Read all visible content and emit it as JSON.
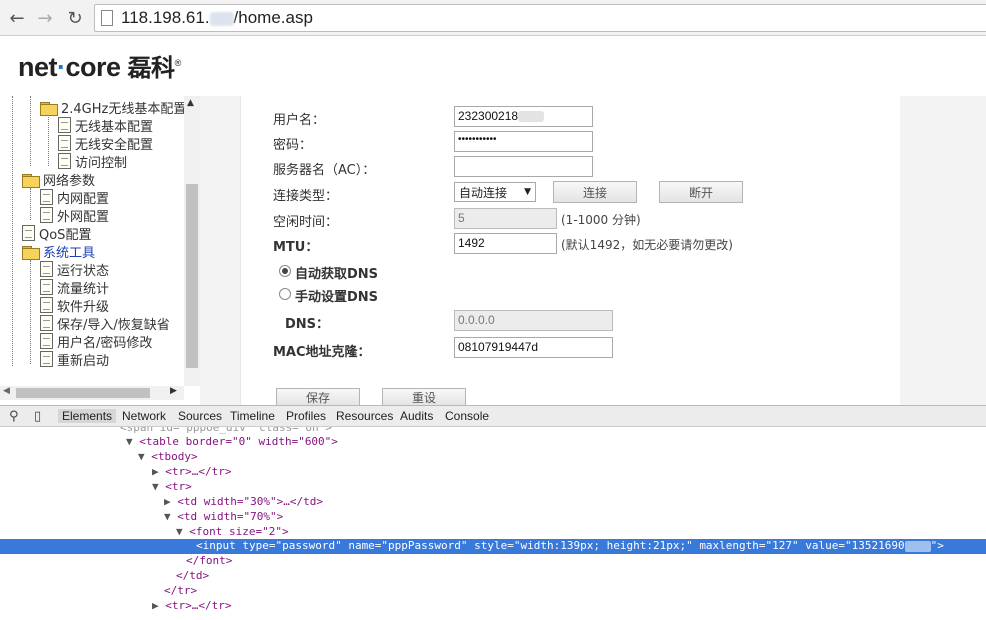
{
  "browser": {
    "url_prefix": "118.198.61.",
    "url_suffix": "/home.asp"
  },
  "logo": {
    "part1": "net",
    "part2": "core",
    "cn": "磊科",
    "reg": "®"
  },
  "tree": {
    "items": [
      {
        "label": "2.4GHz无线基本配置",
        "icon": "folder-open-icon",
        "level": 2
      },
      {
        "label": "无线基本配置",
        "icon": "page-icon",
        "level": 3
      },
      {
        "label": "无线安全配置",
        "icon": "page-icon",
        "level": 3
      },
      {
        "label": "访问控制",
        "icon": "page-icon",
        "level": 3
      },
      {
        "label": "网络参数",
        "icon": "folder-open-icon",
        "level": 1
      },
      {
        "label": "内网配置",
        "icon": "page-icon",
        "level": 2
      },
      {
        "label": "外网配置",
        "icon": "page-icon",
        "level": 2
      },
      {
        "label": "QoS配置",
        "icon": "page-icon",
        "level": 1
      },
      {
        "label": "系统工具",
        "icon": "folder-open-icon",
        "level": 1
      },
      {
        "label": "运行状态",
        "icon": "page-icon",
        "level": 2
      },
      {
        "label": "流量统计",
        "icon": "page-icon",
        "level": 2
      },
      {
        "label": "软件升级",
        "icon": "page-icon",
        "level": 2
      },
      {
        "label": "保存/导入/恢复缺省",
        "icon": "page-icon",
        "level": 2
      },
      {
        "label": "用户名/密码修改",
        "icon": "page-icon",
        "level": 2
      },
      {
        "label": "重新启动",
        "icon": "page-icon",
        "level": 2
      }
    ]
  },
  "form": {
    "username_label": "用户名：",
    "username_value": "232300218",
    "password_label": "密码：",
    "password_value": "•••••••••••",
    "server_label": "服务器名（AC）：",
    "server_value": "",
    "conn_type_label": "连接类型：",
    "conn_type_value": "自动连接",
    "connect_btn": "连接",
    "disconnect_btn": "断开",
    "idle_label": "空闲时间：",
    "idle_value": "5",
    "idle_hint": "(1-1000 分钟)",
    "mtu_label": "MTU：",
    "mtu_value": "1492",
    "mtu_hint": "(默认1492，如无必要请勿更改)",
    "dns_auto_label": "自动获取DNS",
    "dns_manual_label": "手动设置DNS",
    "dns_label": "DNS：",
    "dns_value": "0.0.0.0",
    "mac_label": "MAC地址克隆：",
    "mac_value": "08107919447d",
    "save_btn": "保存",
    "reset_btn": "重设"
  },
  "devtools": {
    "tabs": [
      "Elements",
      "Network",
      "Sources",
      "Timeline",
      "Profiles",
      "Resources",
      "Audits",
      "Console"
    ],
    "lines": [
      {
        "indent": 126,
        "tri": "▼",
        "text": "<table border=\"0\" width=\"600\">"
      },
      {
        "indent": 138,
        "tri": "▼",
        "text": "<tbody>"
      },
      {
        "indent": 152,
        "tri": "▶",
        "text": "<tr>…</tr>"
      },
      {
        "indent": 152,
        "tri": "▼",
        "text": "<tr>"
      },
      {
        "indent": 164,
        "tri": "▶",
        "text": "<td width=\"30%\">…</td>"
      },
      {
        "indent": 164,
        "tri": "▼",
        "text": "<td width=\"70%\">"
      },
      {
        "indent": 176,
        "tri": "▼",
        "text": "<font size=\"2\">"
      },
      {
        "indent": 186,
        "tri": "",
        "text": "</font>"
      },
      {
        "indent": 176,
        "tri": "",
        "text": "</td>"
      },
      {
        "indent": 164,
        "tri": "",
        "text": "</tr>"
      },
      {
        "indent": 152,
        "tri": "▶",
        "text": "<tr>…</tr>"
      }
    ],
    "selected_line": "<input type=\"password\" name=\"pppPassword\" style=\"width:139px; height:21px;\" maxlength=\"127\" value=\"13521690"
  }
}
